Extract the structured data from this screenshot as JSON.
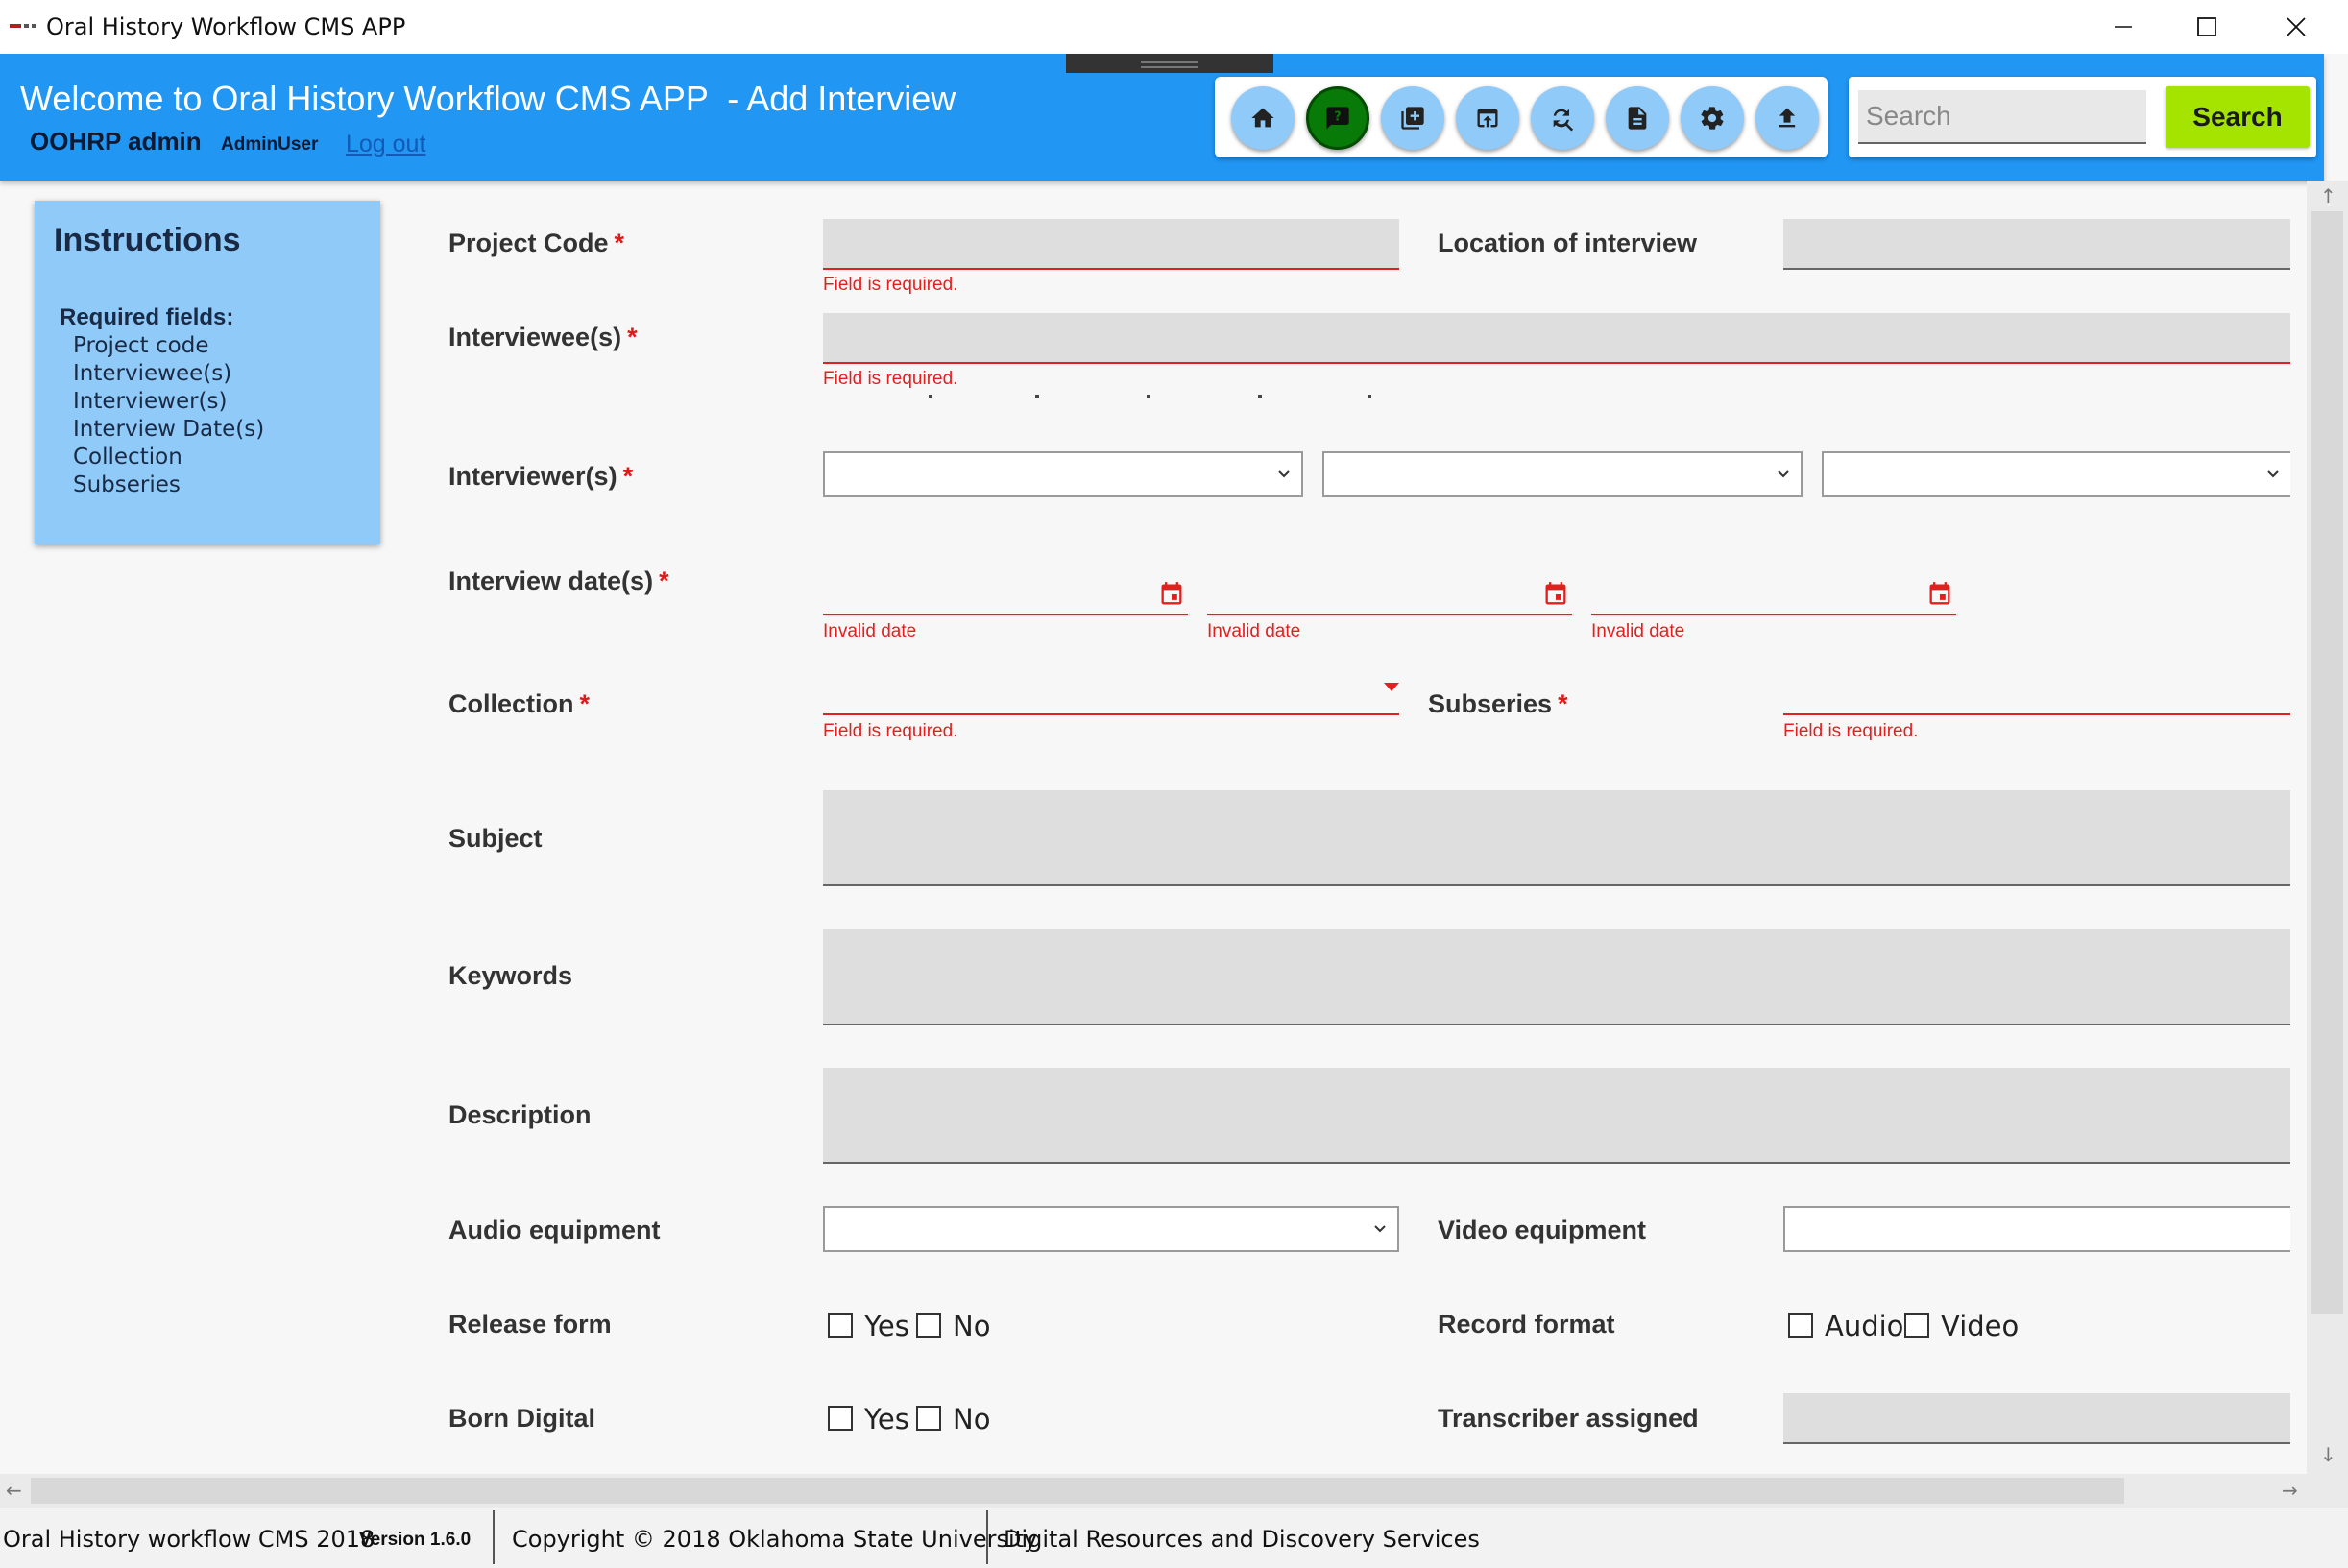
{
  "window": {
    "title": "Oral History Workflow CMS APP"
  },
  "header": {
    "title": "Welcome to Oral History Workflow CMS APP  - Add Interview",
    "user": "OOHRP admin",
    "role": "AdminUser",
    "logout": "Log out",
    "toolbar_icons": [
      "home-icon",
      "feedback-icon",
      "add-library-icon",
      "open-in-browser-icon",
      "find-replace-icon",
      "description-icon",
      "settings-icon",
      "upload-icon"
    ],
    "active_icon": "feedback-icon",
    "search": {
      "placeholder": "Search",
      "button": "Search"
    }
  },
  "instructions": {
    "title": "Instructions",
    "subtitle": "Required fields:",
    "items": [
      "Project code",
      "Interviewee(s)",
      "Interviewer(s)",
      "Interview Date(s)",
      "Collection",
      "Subseries"
    ]
  },
  "form": {
    "required_marker": "*",
    "project_code": {
      "label": "Project Code",
      "error": "Field is required."
    },
    "location": {
      "label": "Location of interview"
    },
    "interviewees": {
      "label": "Interviewee(s)",
      "error": "Field is required."
    },
    "interviewers": {
      "label": "Interviewer(s)"
    },
    "interview_dates": {
      "label": "Interview date(s)",
      "errors": [
        "Invalid date",
        "Invalid date",
        "Invalid date"
      ]
    },
    "collection": {
      "label": "Collection",
      "error": "Field is required."
    },
    "subseries": {
      "label": "Subseries",
      "error": "Field is required."
    },
    "subject": {
      "label": "Subject"
    },
    "keywords": {
      "label": "Keywords"
    },
    "description": {
      "label": "Description"
    },
    "audio_equipment": {
      "label": "Audio equipment"
    },
    "video_equipment": {
      "label": "Video equipment"
    },
    "release_form": {
      "label": "Release form",
      "options": [
        "Yes",
        "No"
      ]
    },
    "record_format": {
      "label": "Record format",
      "options": [
        "Audio",
        "Video"
      ]
    },
    "born_digital": {
      "label": "Born Digital",
      "options": [
        "Yes",
        "No"
      ]
    },
    "transcriber": {
      "label": "Transcriber assigned"
    }
  },
  "footer": {
    "app": "Oral History workflow CMS 2018",
    "version": "Version 1.6.0",
    "copyright": "Copyright © 2018 Oklahoma State University",
    "dept": "Digital Resources and Discovery Services"
  },
  "colors": {
    "header_bg": "#2196f3",
    "instructions_bg": "#90caf9",
    "error": "#e32020",
    "search_button": "#a4e400",
    "active_toolbar": "#087a08"
  }
}
